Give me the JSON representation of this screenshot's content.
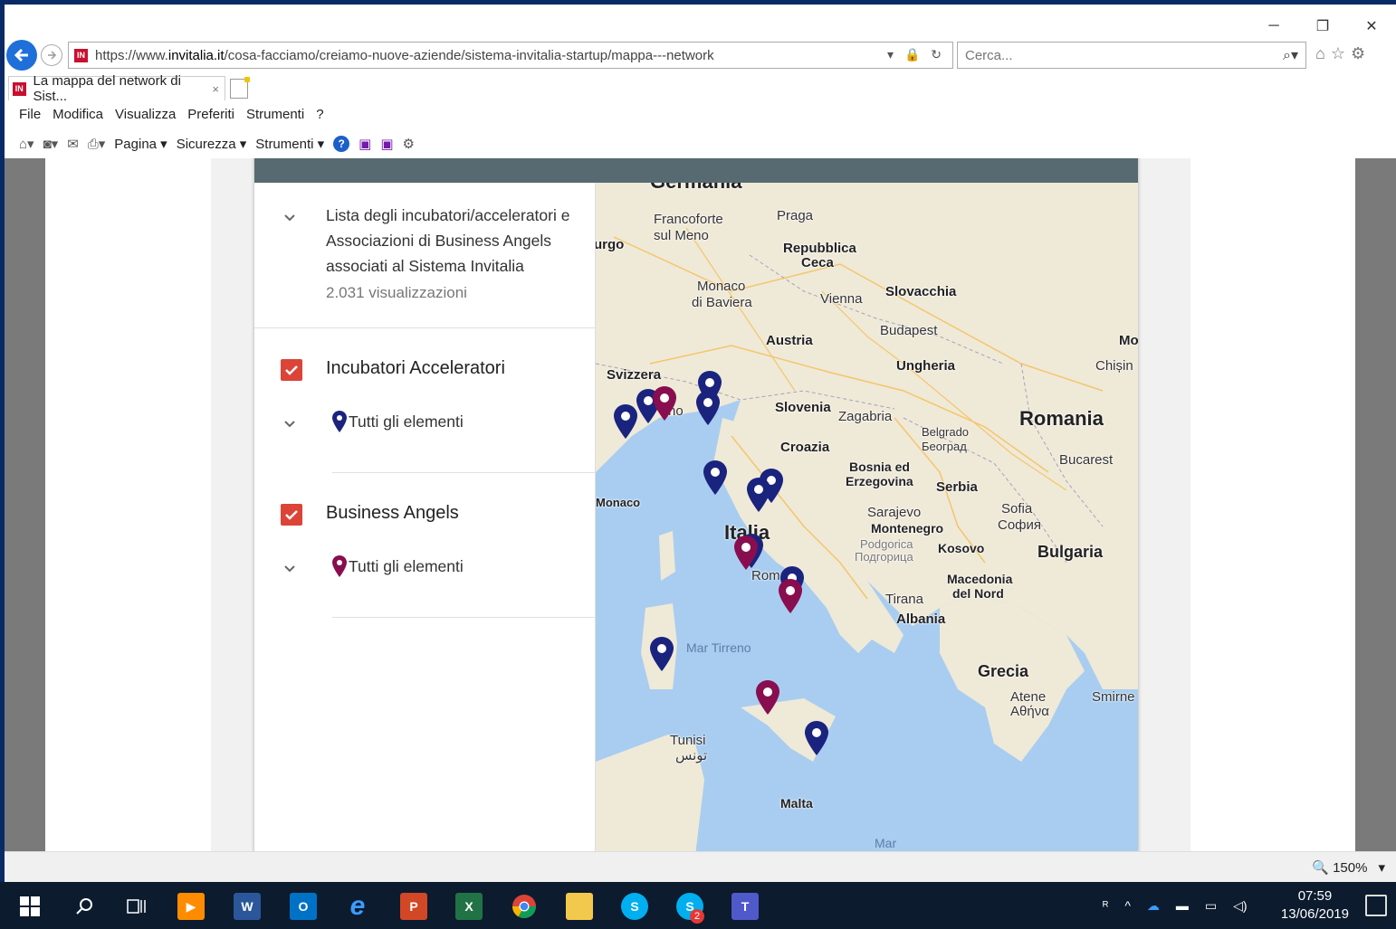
{
  "browser": {
    "url_prefix": "https://www.",
    "url_domain": "invitalia.it",
    "url_path": "/cosa-facciamo/creiamo-nuove-aziende/sistema-invitalia-startup/mappa---network",
    "url_tools": "▾ 🔒 ↻",
    "search_placeholder": "Cerca...",
    "tab_title": "La mappa del network di Sist...",
    "tab_close": "×",
    "favicon_text": "IN",
    "window_minimize": "─",
    "window_restore": "❐",
    "window_close": "✕",
    "zoom_label": "150%",
    "zoom_icon": "🔍"
  },
  "menu": {
    "items": [
      "File",
      "Modifica",
      "Visualizza",
      "Preferiti",
      "Strumenti",
      "?"
    ]
  },
  "commandbar": {
    "pagina": "Pagina ▾",
    "sicurezza": "Sicurezza ▾",
    "strumenti": "Strumenti ▾",
    "help": "?"
  },
  "sidebar": {
    "title": "Lista degli incubatori/acceleratori e Associazioni di Business Angels associati al Sistema Invitalia",
    "views": "2.031 visualizzazioni",
    "layers": [
      {
        "name": "Incubatori Acceleratori",
        "item": "Tutti gli elementi",
        "color": "#1a237e"
      },
      {
        "name": "Business Angels",
        "item": "Tutti gli elementi",
        "color": "#880e4f"
      }
    ]
  },
  "map": {
    "labels": {
      "germania": "Germania",
      "francoforte": "Francoforte",
      "sul_meno": "sul Meno",
      "praga": "Praga",
      "repubblica": "Repubblica",
      "ceca": "Ceca",
      "urgo": "urgo",
      "monaco_baviera1": "Monaco",
      "monaco_baviera2": "di Baviera",
      "vienna": "Vienna",
      "slovacchia": "Slovacchia",
      "austria": "Austria",
      "budapest": "Budapest",
      "mo": "Mo",
      "chisina": "Chișin",
      "svizzera": "Svizzera",
      "ungheria": "Ungheria",
      "slovenia": "Slovenia",
      "zagabria": "Zagabria",
      "romania": "Romania",
      "belgrado": "Belgrado",
      "beograd": "Београд",
      "croazia": "Croazia",
      "bucarest": "Bucarest",
      "bosnia1": "Bosnia ed",
      "bosnia2": "Erzegovina",
      "serbia": "Serbia",
      "monaco": "Monaco",
      "sarajevo": "Sarajevo",
      "italia": "Italia",
      "montenegro": "Montenegro",
      "sofia": "Sofia",
      "sofia_cyr": "София",
      "podgorica": "Podgorica",
      "podgorica_cyr": "Подгорица",
      "kosovo": "Kosovo",
      "bulgaria": "Bulgaria",
      "roma": "Rom",
      "macedonia1": "Macedonia",
      "macedonia2": "del Nord",
      "tirana": "Tirana",
      "albania": "Albania",
      "mar_tirreno": "Mar Tirreno",
      "grecia": "Grecia",
      "atene": "Atene",
      "atene_gr": "Αθήνα",
      "smirne": "Smirne",
      "tunisi": "Tunisi",
      "tunisi_ar": "تونس",
      "malta": "Malta",
      "mar": "Mar",
      "milano_frag": "no"
    }
  },
  "taskbar": {
    "time": "07:59",
    "date": "13/06/2019",
    "word": "W",
    "outlook": "O",
    "ppt": "P",
    "excel": "X",
    "badge": "2"
  }
}
